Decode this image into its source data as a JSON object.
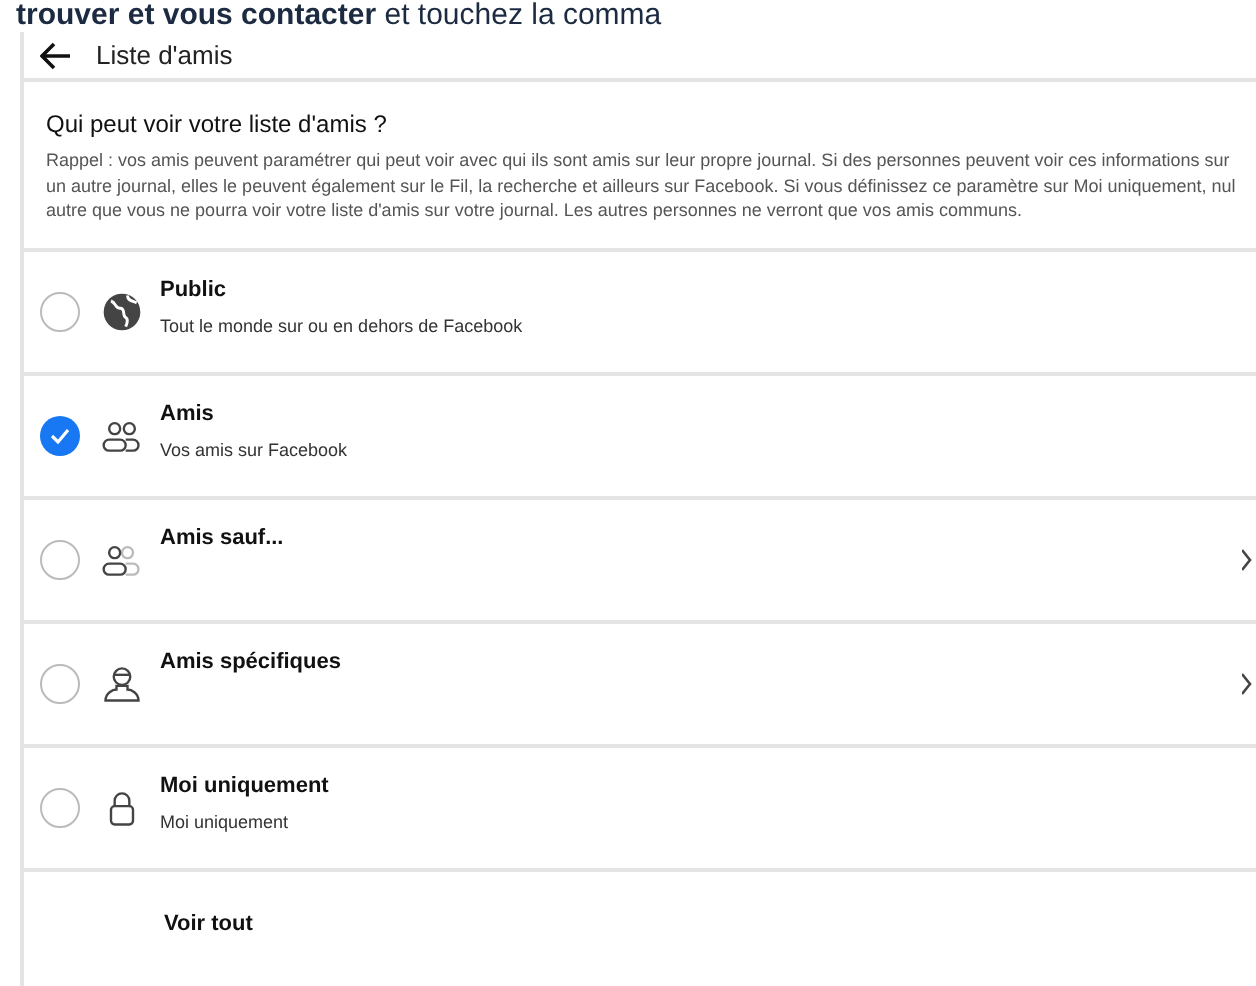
{
  "banner": "**trouver et vous contacter** et touchez la comma",
  "header": {
    "title": "Liste d'amis"
  },
  "question": "Qui peut voir votre liste d'amis ?",
  "reminder": "Rappel : vos amis peuvent paramétrer qui peut voir avec qui ils sont amis sur leur propre journal. Si des personnes peuvent voir ces informations sur un autre journal, elles le peuvent également sur le Fil, la recherche et ailleurs sur Facebook. Si vous définissez ce paramètre sur Moi uniquement, nul autre que vous ne pourra voir votre liste d'amis sur votre journal. Les autres personnes ne verront que vos amis communs.",
  "options": [
    {
      "kind": "globe",
      "label": "Public",
      "description": "Tout le monde sur ou en dehors de Facebook",
      "selected": false,
      "chevron": false
    },
    {
      "kind": "friends",
      "label": "Amis",
      "description": "Vos amis sur Facebook",
      "selected": true,
      "chevron": false
    },
    {
      "kind": "friends-except",
      "label": "Amis sauf...",
      "selected": false,
      "chevron": true
    },
    {
      "kind": "person",
      "label": "Amis spécifiques",
      "selected": false,
      "chevron": true
    },
    {
      "kind": "lock",
      "label": "Moi uniquement",
      "description": "Moi uniquement",
      "selected": false,
      "chevron": false
    }
  ],
  "see_all": "Voir tout"
}
